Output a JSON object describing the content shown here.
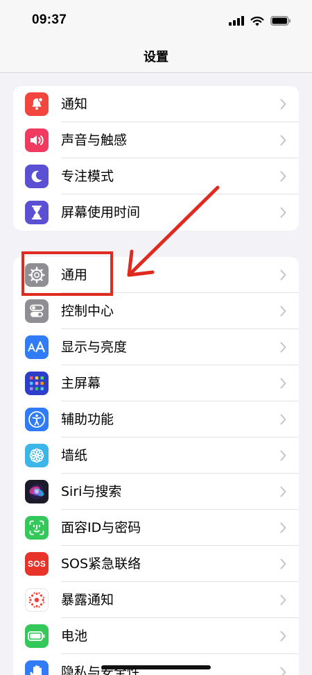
{
  "status_bar": {
    "time": "09:37",
    "icons": [
      "cellular-signal-icon",
      "wifi-icon",
      "battery-icon"
    ]
  },
  "nav": {
    "title": "设置"
  },
  "groups": [
    {
      "items": [
        {
          "label": "通知",
          "icon": "bell-icon",
          "color": "#f2453d"
        },
        {
          "label": "声音与触感",
          "icon": "speaker-icon",
          "color": "#f03a5f"
        },
        {
          "label": "专注模式",
          "icon": "moon-icon",
          "color": "#5b4fd4"
        },
        {
          "label": "屏幕使用时间",
          "icon": "hourglass-icon",
          "color": "#5b4fd4"
        }
      ]
    },
    {
      "items": [
        {
          "label": "通用",
          "icon": "gear-icon",
          "color": "#8e8e93"
        },
        {
          "label": "控制中心",
          "icon": "toggles-icon",
          "color": "#8e8e93"
        },
        {
          "label": "显示与亮度",
          "icon": "text-size-icon",
          "color": "#2f7cf6"
        },
        {
          "label": "主屏幕",
          "icon": "app-grid-icon",
          "color": "#2d3ec9"
        },
        {
          "label": "辅助功能",
          "icon": "accessibility-icon",
          "color": "#2f7cf6"
        },
        {
          "label": "墙纸",
          "icon": "flower-icon",
          "color": "#3cb6e8"
        },
        {
          "label": "Siri与搜索",
          "icon": "siri-icon",
          "color": "#1b1b2a"
        },
        {
          "label": "面容ID与密码",
          "icon": "face-id-icon",
          "color": "#34c759"
        },
        {
          "label": "SOS紧急联络",
          "icon": "sos-icon",
          "color": "#e8332a",
          "icon_text": "SOS"
        },
        {
          "label": "暴露通知",
          "icon": "exposure-icon",
          "color": "#ffffff"
        },
        {
          "label": "电池",
          "icon": "battery-setting-icon",
          "color": "#34c759"
        },
        {
          "label": "隐私与安全性",
          "icon": "hand-icon",
          "color": "#2f7cf6"
        }
      ]
    }
  ],
  "annotation": {
    "highlighted_item": "通用",
    "color": "#e02a1f"
  }
}
